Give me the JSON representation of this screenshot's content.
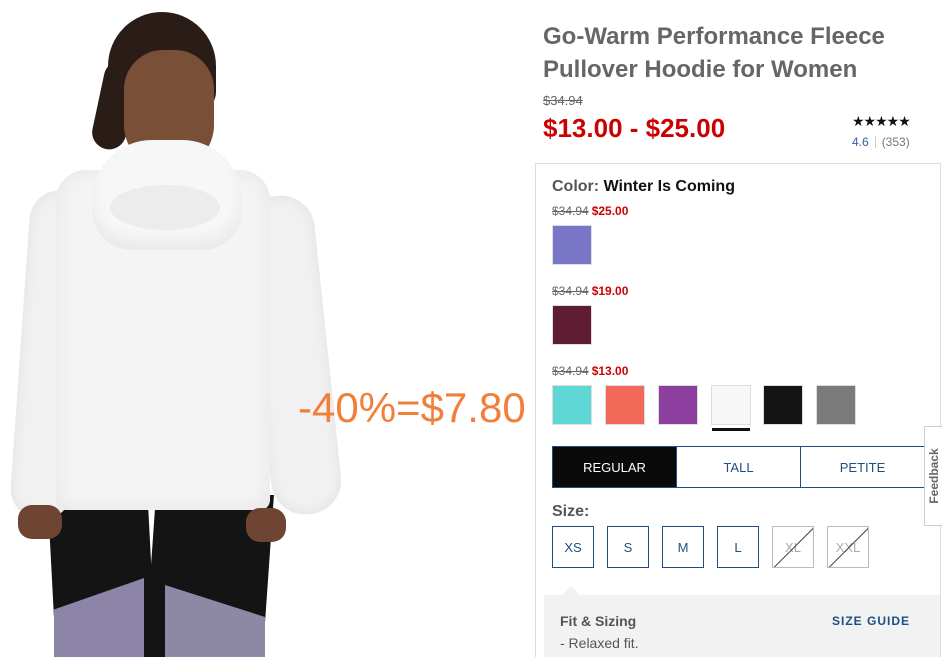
{
  "product": {
    "title_line1": "Go-Warm Performance Fleece",
    "title_line2": "Pullover Hoodie for Women",
    "original_price": "$34.94",
    "price_range": "$13.00 - $25.00",
    "rating_stars": "★★★★★",
    "rating_value": "4.6",
    "review_count": "(353)"
  },
  "promo_overlay": "-40%=$7.80",
  "color": {
    "label": "Color:",
    "selected_name": "Winter Is Coming",
    "groups": [
      {
        "original": "$34.94",
        "sale": "$25.00",
        "swatches": [
          {
            "name": "swatch-heather-purple",
            "color": "#7a76c7"
          }
        ]
      },
      {
        "original": "$34.94",
        "sale": "$19.00",
        "swatches": [
          {
            "name": "swatch-burgundy",
            "color": "#5e1d33"
          }
        ]
      },
      {
        "original": "$34.94",
        "sale": "$13.00",
        "swatches": [
          {
            "name": "swatch-aqua",
            "color": "#5fd8d5"
          },
          {
            "name": "swatch-coral",
            "color": "#f2695a"
          },
          {
            "name": "swatch-violet",
            "color": "#8c3f9f"
          },
          {
            "name": "swatch-white",
            "color": "#f7f7f7",
            "selected": true
          },
          {
            "name": "swatch-black",
            "color": "#141414"
          },
          {
            "name": "swatch-gray",
            "color": "#7a7a7a"
          }
        ]
      }
    ]
  },
  "fit_tabs": [
    {
      "label": "REGULAR",
      "active": true
    },
    {
      "label": "TALL",
      "active": false
    },
    {
      "label": "PETITE",
      "active": false
    }
  ],
  "size": {
    "label": "Size:",
    "options": [
      {
        "label": "XS",
        "available": true
      },
      {
        "label": "S",
        "available": true
      },
      {
        "label": "M",
        "available": true
      },
      {
        "label": "L",
        "available": true
      },
      {
        "label": "XL",
        "available": false
      },
      {
        "label": "XXL",
        "available": false
      }
    ]
  },
  "fit_sizing": {
    "title": "Fit & Sizing",
    "note": "- Relaxed fit.",
    "guide_link": "SIZE GUIDE"
  },
  "feedback_tab": "Feedback",
  "colors": {
    "sale_red": "#cc0000",
    "link_blue": "#1d4f82",
    "promo_orange": "#f07f3c"
  }
}
